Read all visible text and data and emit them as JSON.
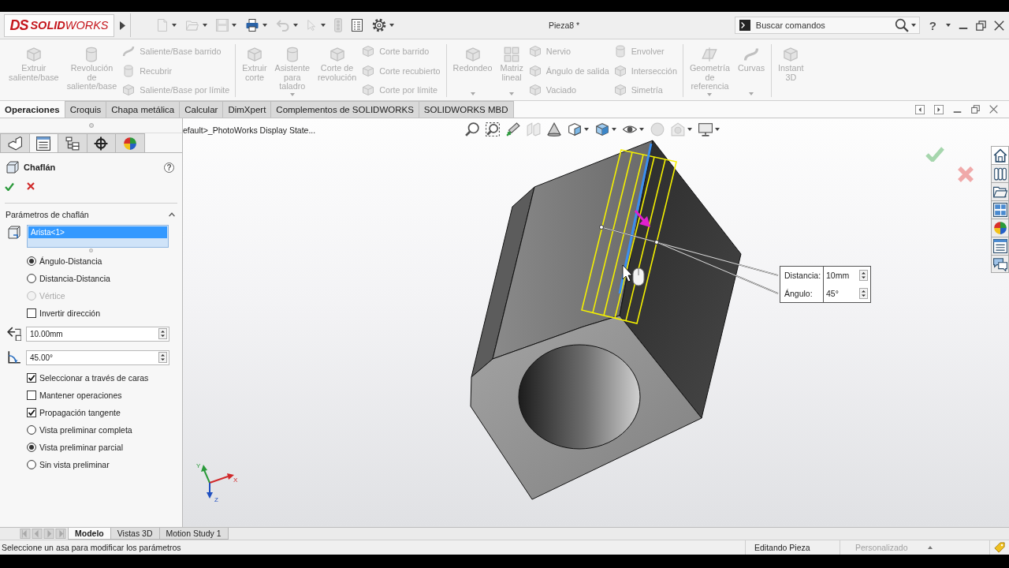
{
  "title_bar": {
    "logo": {
      "mark": "DS",
      "wordmark": "**SOLID**WORKS"
    },
    "quick_access": [
      {
        "disabled": true,
        "dropdown": true
      },
      {
        "disabled": true,
        "dropdown": true
      },
      {
        "disabled": true,
        "dropdown": true
      },
      {
        "disabled": false,
        "dropdown": true
      },
      {
        "disabled": true,
        "dropdown": true
      },
      {
        "disabled": true,
        "dropdown": true
      },
      {
        "disabled": true,
        "dropdown": false
      },
      {
        "disabled": false,
        "dropdown": false
      },
      {
        "disabled": false,
        "dropdown": true
      }
    ],
    "document_title": "Pieza8 *",
    "search": {
      "placeholder": "Buscar comandos"
    },
    "help": "?"
  },
  "ribbon": {
    "groups": [
      {
        "items": [
          {
            "kind": "large",
            "label": "Extruir\nsaliente/base",
            "disabled": true,
            "dropdown": false
          },
          {
            "kind": "large",
            "label": "Revolución\nde\nsaliente/base",
            "disabled": true,
            "dropdown": false
          },
          {
            "kind": "stack",
            "commands": [
              {
                "label": "Saliente/Base barrido",
                "disabled": true
              },
              {
                "label": "Recubrir",
                "disabled": true
              },
              {
                "label": "Saliente/Base por límite",
                "disabled": true
              }
            ]
          }
        ]
      },
      {
        "items": [
          {
            "kind": "large",
            "label": "Extruir\ncorte",
            "disabled": true,
            "dropdown": false
          },
          {
            "kind": "large",
            "label": "Asistente\npara\ntaladro",
            "disabled": true,
            "dropdown": true
          },
          {
            "kind": "large",
            "label": "Corte de\nrevolución",
            "disabled": true,
            "dropdown": false
          },
          {
            "kind": "stack",
            "commands": [
              {
                "label": "Corte barrido",
                "disabled": true
              },
              {
                "label": "Corte recubierto",
                "disabled": true
              },
              {
                "label": "Corte por límite",
                "disabled": true
              }
            ]
          }
        ]
      },
      {
        "items": [
          {
            "kind": "large",
            "label": "Redondeo",
            "disabled": true,
            "dropdown": true
          },
          {
            "kind": "large",
            "label": "Matriz\nlineal",
            "disabled": true,
            "dropdown": true
          },
          {
            "kind": "stack",
            "commands": [
              {
                "label": "Nervio",
                "disabled": true
              },
              {
                "label": "Ángulo de salida",
                "disabled": true
              },
              {
                "label": "Vaciado",
                "disabled": true
              }
            ]
          },
          {
            "kind": "stack",
            "commands": [
              {
                "label": "Envolver",
                "disabled": true
              },
              {
                "label": "Intersección",
                "disabled": true
              },
              {
                "label": "Simetría",
                "disabled": true
              }
            ]
          }
        ]
      },
      {
        "items": [
          {
            "kind": "large",
            "label": "Geometría\nde\nreferencia",
            "disabled": true,
            "dropdown": true
          },
          {
            "kind": "large",
            "label": "Curvas",
            "disabled": true,
            "dropdown": true
          }
        ]
      },
      {
        "items": [
          {
            "kind": "large",
            "label": "Instant\n3D",
            "disabled": true,
            "dropdown": false
          }
        ]
      }
    ]
  },
  "command_tabs": [
    {
      "label": "Operaciones",
      "selected": true
    },
    {
      "label": "Croquis",
      "selected": false
    },
    {
      "label": "Chapa metálica",
      "selected": false
    },
    {
      "label": "Calcular",
      "selected": false
    },
    {
      "label": "DimXpert",
      "selected": false
    },
    {
      "label": "Complementos de SOLIDWORKS",
      "selected": false
    },
    {
      "label": "SOLIDWORKS MBD",
      "selected": false
    }
  ],
  "property_manager": {
    "tabs": [
      {
        "selected": false
      },
      {
        "selected": true
      },
      {
        "selected": false
      },
      {
        "selected": false
      },
      {
        "selected": false
      }
    ],
    "title": "Chaflán",
    "help": "?",
    "section": {
      "title": "Parámetros de chaflán",
      "expanded": true,
      "selection_list": [
        {
          "label": "Arista<1>",
          "selected": true
        }
      ],
      "options": [
        {
          "kind": "radio",
          "label": "Ángulo-Distancia",
          "selected": true,
          "disabled": false
        },
        {
          "kind": "radio",
          "label": "Distancia-Distancia",
          "selected": false,
          "disabled": false
        },
        {
          "kind": "radio",
          "label": "Vértice",
          "selected": false,
          "disabled": true
        },
        {
          "kind": "checkbox",
          "label": "Invertir dirección",
          "checked": false
        },
        {
          "kind": "distance",
          "value": "10.00mm"
        },
        {
          "kind": "angle",
          "value": "45.00°"
        },
        {
          "kind": "checkbox",
          "label": "Seleccionar a través de caras",
          "checked": true
        },
        {
          "kind": "checkbox",
          "label": "Mantener operaciones",
          "checked": false
        },
        {
          "kind": "checkbox",
          "label": "Propagación tangente",
          "checked": true
        },
        {
          "kind": "radio",
          "label": "Vista preliminar completa",
          "selected": false,
          "disabled": false
        },
        {
          "kind": "radio",
          "label": "Vista preliminar parcial",
          "selected": true,
          "disabled": false
        },
        {
          "kind": "radio",
          "label": "Sin vista preliminar",
          "selected": false,
          "disabled": false
        }
      ]
    }
  },
  "viewport": {
    "breadcrumb": "efault>_PhotoWorks Display State...",
    "view_tools": [
      {
        "disabled": false,
        "dropdown": false
      },
      {
        "disabled": false,
        "dropdown": false
      },
      {
        "disabled": false,
        "dropdown": false
      },
      {
        "disabled": true,
        "dropdown": false
      },
      {
        "disabled": false,
        "dropdown": false
      },
      {
        "disabled": false,
        "dropdown": true
      },
      {
        "disabled": false,
        "dropdown": true
      },
      {
        "disabled": false,
        "dropdown": true
      },
      {
        "disabled": true,
        "dropdown": false
      },
      {
        "disabled": true,
        "dropdown": true
      },
      {
        "disabled": false,
        "dropdown": true
      }
    ],
    "callout": {
      "rows": [
        {
          "label": "Distancia:",
          "value": "10mm"
        },
        {
          "label": "Ángulo:",
          "value": "45°"
        }
      ]
    },
    "triad": {
      "labels": [
        "Y",
        "X",
        "Z"
      ]
    }
  },
  "bottom_tabs": [
    {
      "label": "Modelo",
      "selected": true
    },
    {
      "label": "Vistas 3D",
      "selected": false
    },
    {
      "label": "Motion Study 1",
      "selected": false
    }
  ],
  "status_bar": {
    "message": "Seleccione un asa para modificar los parámetros",
    "mode": "Editando Pieza",
    "units": "Personalizado"
  }
}
